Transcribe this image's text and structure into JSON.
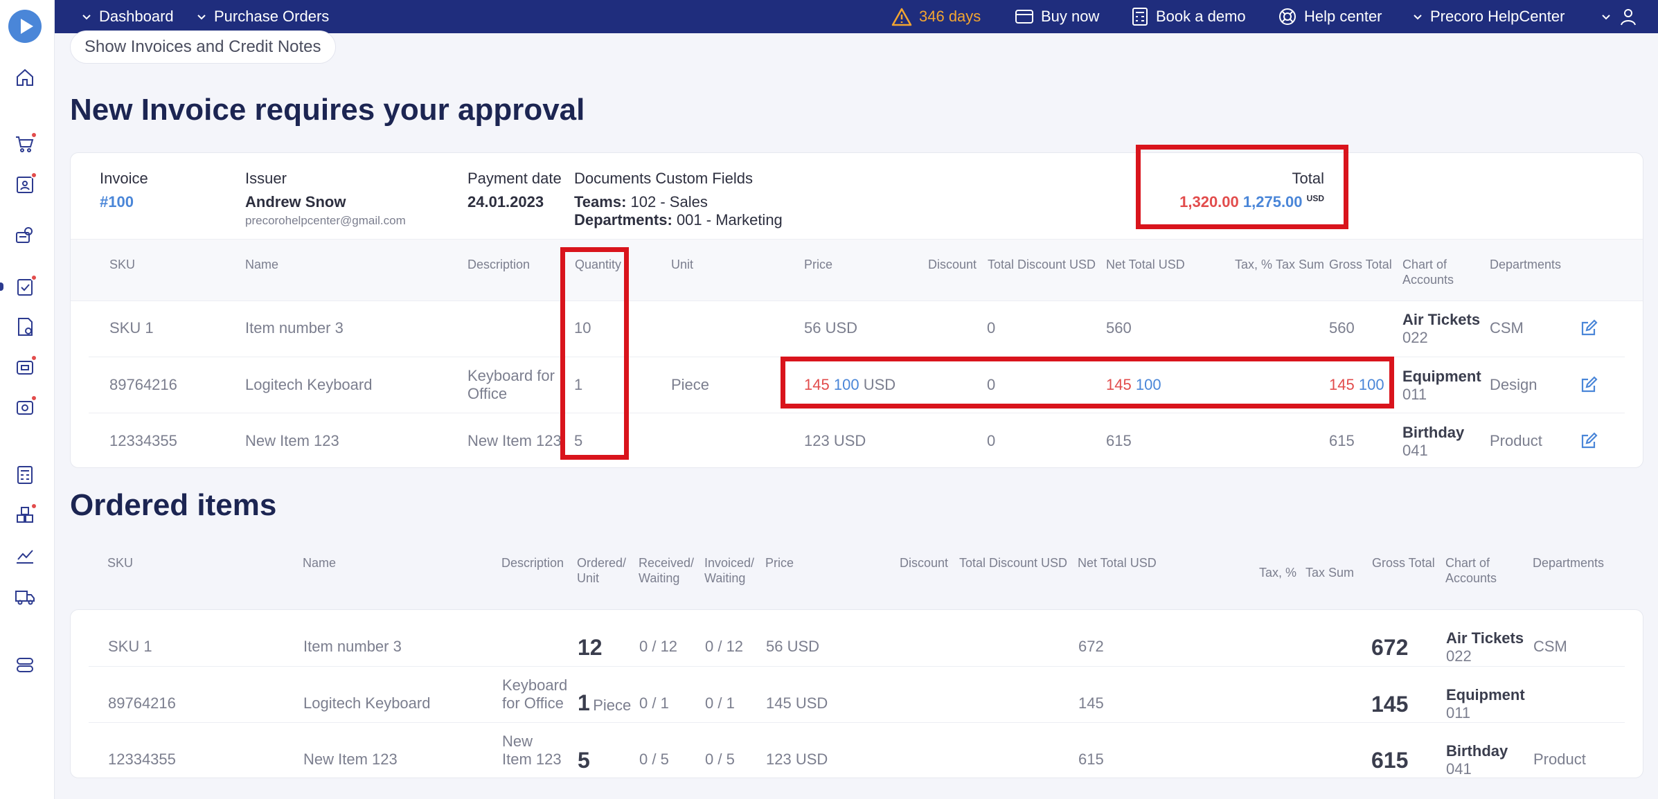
{
  "topbar": {
    "nav": [
      "Dashboard",
      "Purchase Orders"
    ],
    "trial": "346 days",
    "buy_now": "Buy now",
    "book_demo": "Book a demo",
    "help_center": "Help center",
    "company": "Precoro HelpCenter"
  },
  "page": {
    "show_button": "Show Invoices and Credit Notes",
    "title": "New Invoice requires your approval",
    "ordered_title": "Ordered items"
  },
  "invoice": {
    "invoice_label": "Invoice",
    "invoice_number": "#100",
    "issuer_label": "Issuer",
    "issuer_name": "Andrew Snow",
    "issuer_email": "precorohelpcenter@gmail.com",
    "payment_label": "Payment date",
    "payment_date": "24.01.2023",
    "custom_label": "Documents Custom Fields",
    "teams_label": "Teams:",
    "teams_value": "102 - Sales",
    "departments_label": "Departments:",
    "departments_value": "001 - Marketing",
    "total_label": "Total",
    "total_old": "1,320.00",
    "total_new": "1,275.00",
    "total_currency": "USD"
  },
  "invoice_table": {
    "headers": [
      "SKU",
      "Name",
      "Description",
      "Quantity",
      "Unit",
      "Price",
      "Discount",
      "Total Discount USD",
      "Net Total USD",
      "Tax, %",
      "Tax Sum",
      "Gross Total",
      "Chart of",
      "Accounts",
      "Departments"
    ],
    "rows": [
      {
        "sku": "SKU 1",
        "name": "Item number 3",
        "desc1": "",
        "desc2": "",
        "qty": "10",
        "unit": "",
        "price": "56 USD",
        "price_old": "",
        "price_new": "",
        "price_cur": "",
        "total_discount": "0",
        "net": "560",
        "net_old": "",
        "net_new": "",
        "gross": "560",
        "gross_old": "",
        "gross_new": "",
        "account": "Air Tickets",
        "account_code": "022",
        "department": "CSM"
      },
      {
        "sku": "89764216",
        "name": "Logitech Keyboard",
        "desc1": "Keyboard for",
        "desc2": "Office",
        "qty": "1",
        "unit": "Piece",
        "price": "",
        "price_old": "145",
        "price_new": "100",
        "price_cur": "USD",
        "total_discount": "0",
        "net": "",
        "net_old": "145",
        "net_new": "100",
        "gross": "",
        "gross_old": "145",
        "gross_new": "100",
        "account": "Equipment",
        "account_code": "011",
        "department": "Design"
      },
      {
        "sku": "12334355",
        "name": "New Item 123",
        "desc1": "New Item 123",
        "desc2": "",
        "qty": "5",
        "unit": "",
        "price": "123 USD",
        "price_old": "",
        "price_new": "",
        "price_cur": "",
        "total_discount": "0",
        "net": "615",
        "net_old": "",
        "net_new": "",
        "gross": "615",
        "gross_old": "",
        "gross_new": "",
        "account": "Birthday",
        "account_code": "041",
        "department": "Product"
      }
    ]
  },
  "ordered_table": {
    "headers": {
      "sku": "SKU",
      "name": "Name",
      "description": "Description",
      "ordered1": "Ordered/",
      "ordered2": "Unit",
      "received1": "Received/",
      "received2": "Waiting",
      "invoiced1": "Invoiced/",
      "invoiced2": "Waiting",
      "price": "Price",
      "discount": "Discount",
      "total_discount": "Total Discount USD",
      "net_total": "Net Total USD",
      "tax": "Tax, %",
      "tax_sum": "Tax Sum",
      "gross_total": "Gross Total",
      "chart1": "Chart of",
      "chart2": "Accounts",
      "departments": "Departments"
    },
    "rows": [
      {
        "sku": "SKU 1",
        "name": "Item number 3",
        "desc1": "",
        "desc2": "",
        "ordered": "12",
        "unit": "",
        "received": "0 / 12",
        "invoiced": "0 / 12",
        "price": "56 USD",
        "net": "672",
        "gross": "672",
        "account": "Air Tickets",
        "account_code": "022",
        "department": "CSM"
      },
      {
        "sku": "89764216",
        "name": "Logitech Keyboard",
        "desc1": "Keyboard",
        "desc2": "for Office",
        "ordered": "1",
        "unit": "Piece",
        "received": "0 / 1",
        "invoiced": "0 / 1",
        "price": "145 USD",
        "net": "145",
        "gross": "145",
        "account": "Equipment",
        "account_code": "011",
        "department": ""
      },
      {
        "sku": "12334355",
        "name": "New Item 123",
        "desc1": "New",
        "desc2": "Item 123",
        "ordered": "5",
        "unit": "",
        "received": "0 / 5",
        "invoiced": "0 / 5",
        "price": "123 USD",
        "net": "615",
        "gross": "615",
        "account": "Birthday",
        "account_code": "041",
        "department": "Product"
      }
    ]
  },
  "colors": {
    "nav": "#1f2d7d",
    "accent": "#4a86d8",
    "old_value": "#e24c4c",
    "highlight": "#d9141c",
    "warning": "#f2a531"
  }
}
